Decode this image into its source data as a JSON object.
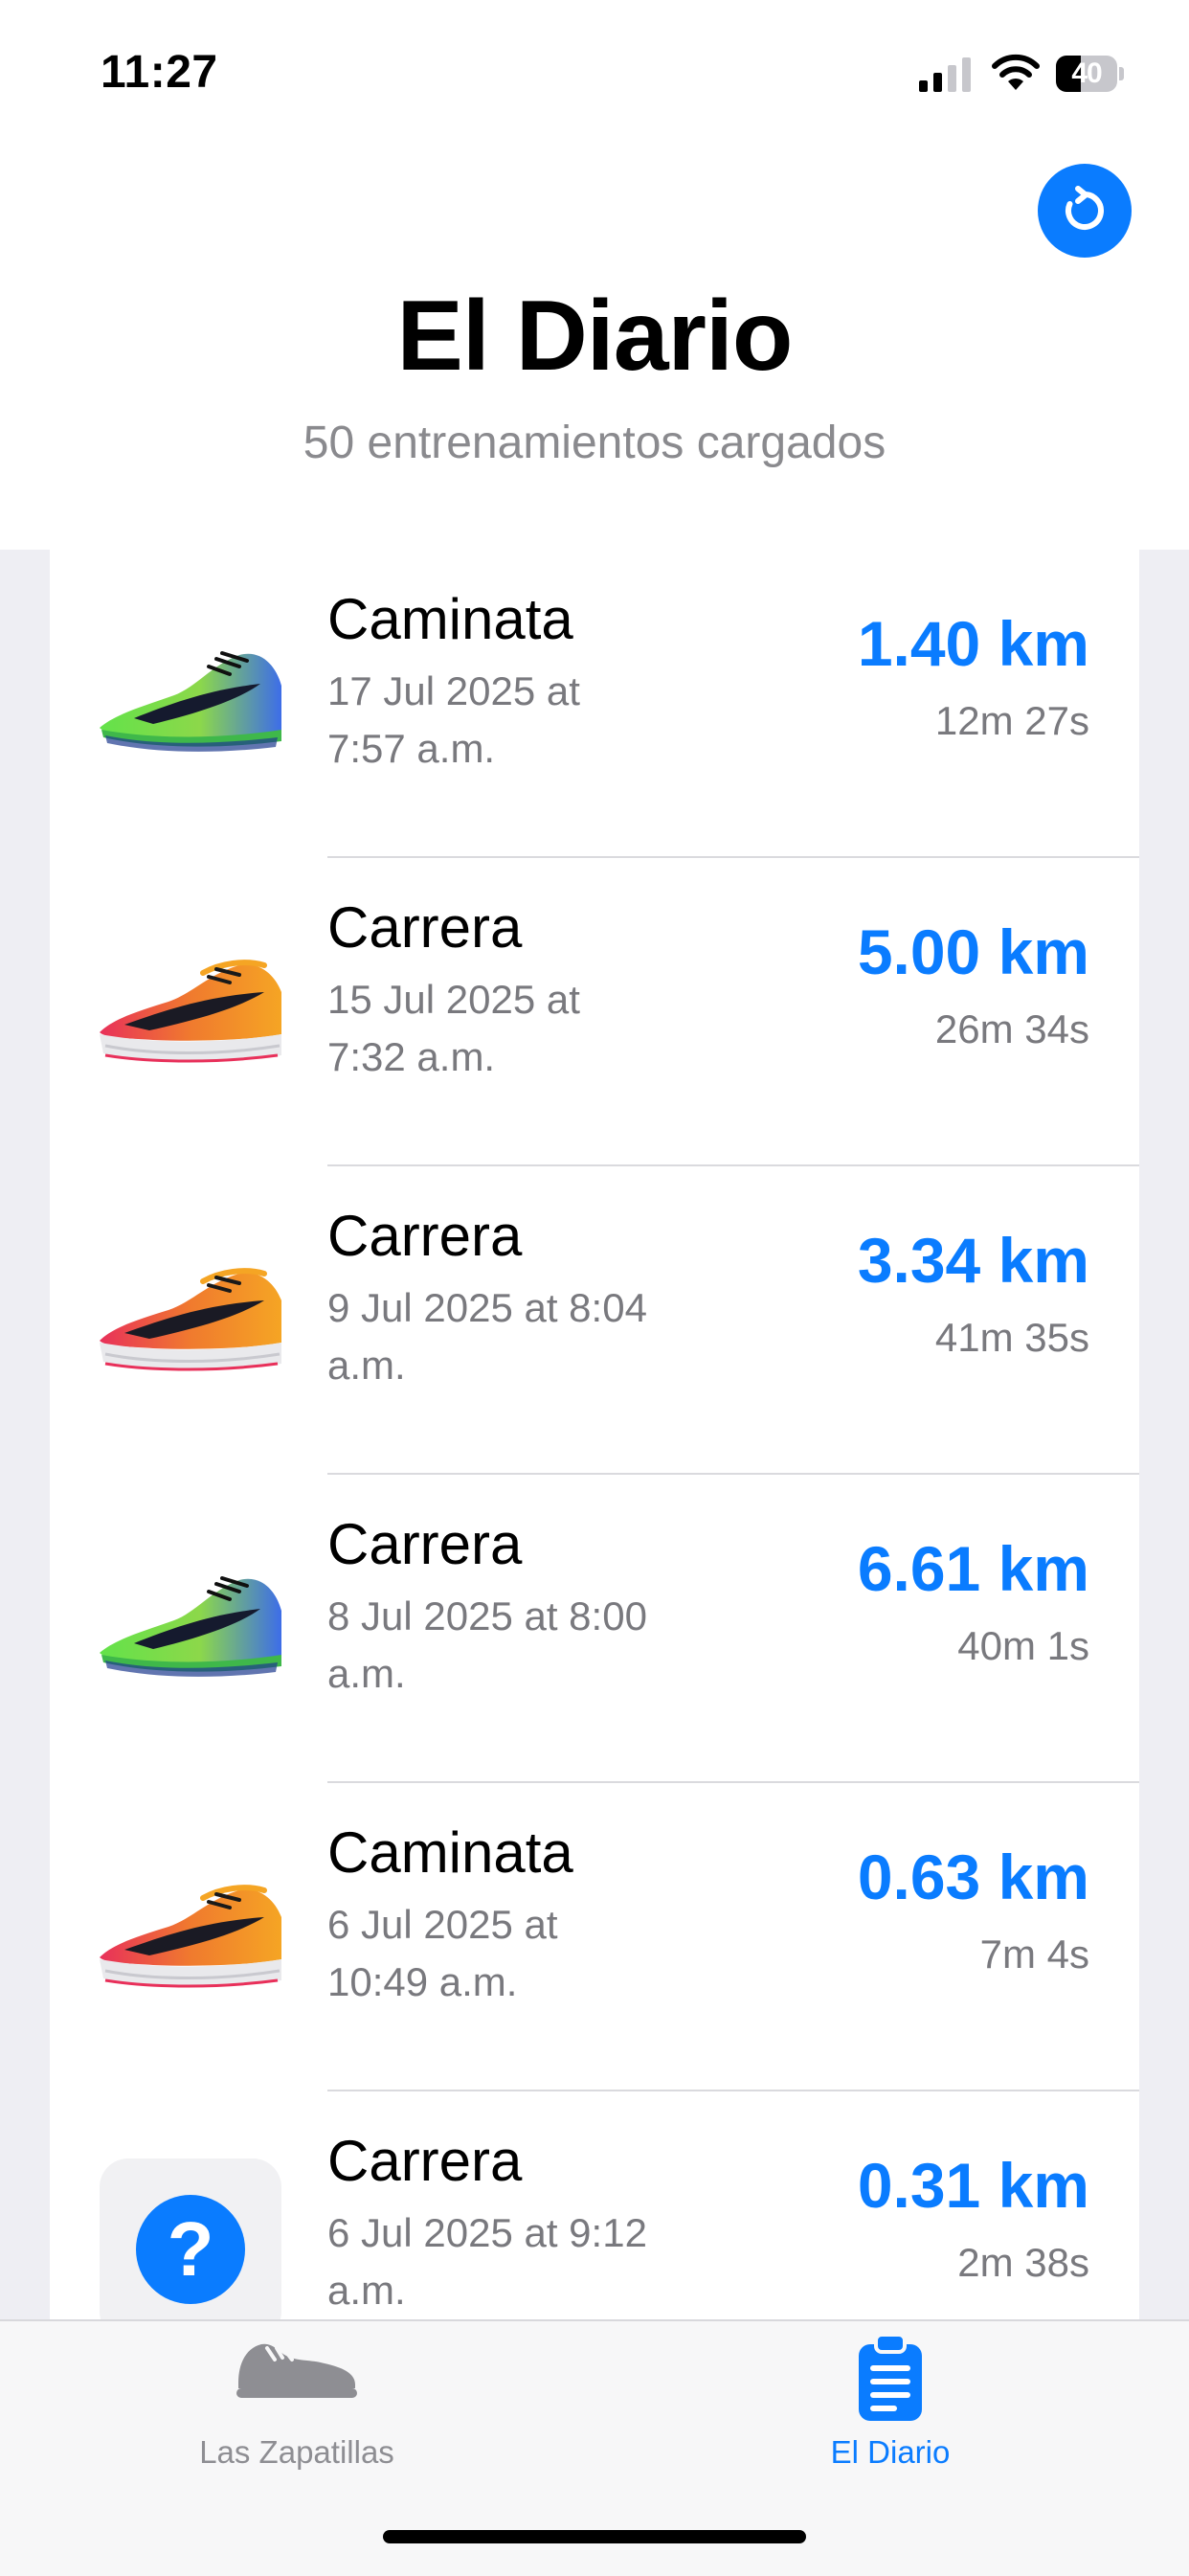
{
  "status_bar": {
    "time": "11:27",
    "battery": "40",
    "battery_level": 0.4
  },
  "header": {
    "title": "El Diario",
    "subtitle": "50 entrenamientos cargados",
    "refresh_icon": "refresh-icon"
  },
  "workouts": [
    {
      "type": "Caminata",
      "date": "17 Jul 2025 at 7:57 a.m.",
      "distance": "1.40 km",
      "duration": "12m 27s",
      "shoe": "green-blue"
    },
    {
      "type": "Carrera",
      "date": "15 Jul 2025 at 7:32 a.m.",
      "distance": "5.00 km",
      "duration": "26m 34s",
      "shoe": "orange-pink"
    },
    {
      "type": "Carrera",
      "date": "9 Jul 2025 at 8:04 a.m.",
      "distance": "3.34 km",
      "duration": "41m 35s",
      "shoe": "orange-pink"
    },
    {
      "type": "Carrera",
      "date": "8 Jul 2025 at 8:00 a.m.",
      "distance": "6.61 km",
      "duration": "40m 1s",
      "shoe": "green-blue"
    },
    {
      "type": "Caminata",
      "date": "6 Jul 2025 at 10:49 a.m.",
      "distance": "0.63 km",
      "duration": "7m 4s",
      "shoe": "orange-pink"
    },
    {
      "type": "Carrera",
      "date": "6 Jul 2025 at 9:12 a.m.",
      "distance": "0.31 km",
      "duration": "2m 38s",
      "shoe": "unknown"
    }
  ],
  "unknown_thumb_glyph": "?",
  "tabs": [
    {
      "label": "Las Zapatillas",
      "icon": "shoe-icon",
      "active": false
    },
    {
      "label": "El Diario",
      "icon": "clipboard-icon",
      "active": true
    }
  ],
  "colors": {
    "accent": "#0a7cff",
    "secondary_text": "#79797e",
    "inactive_tab": "#8e8e93"
  }
}
